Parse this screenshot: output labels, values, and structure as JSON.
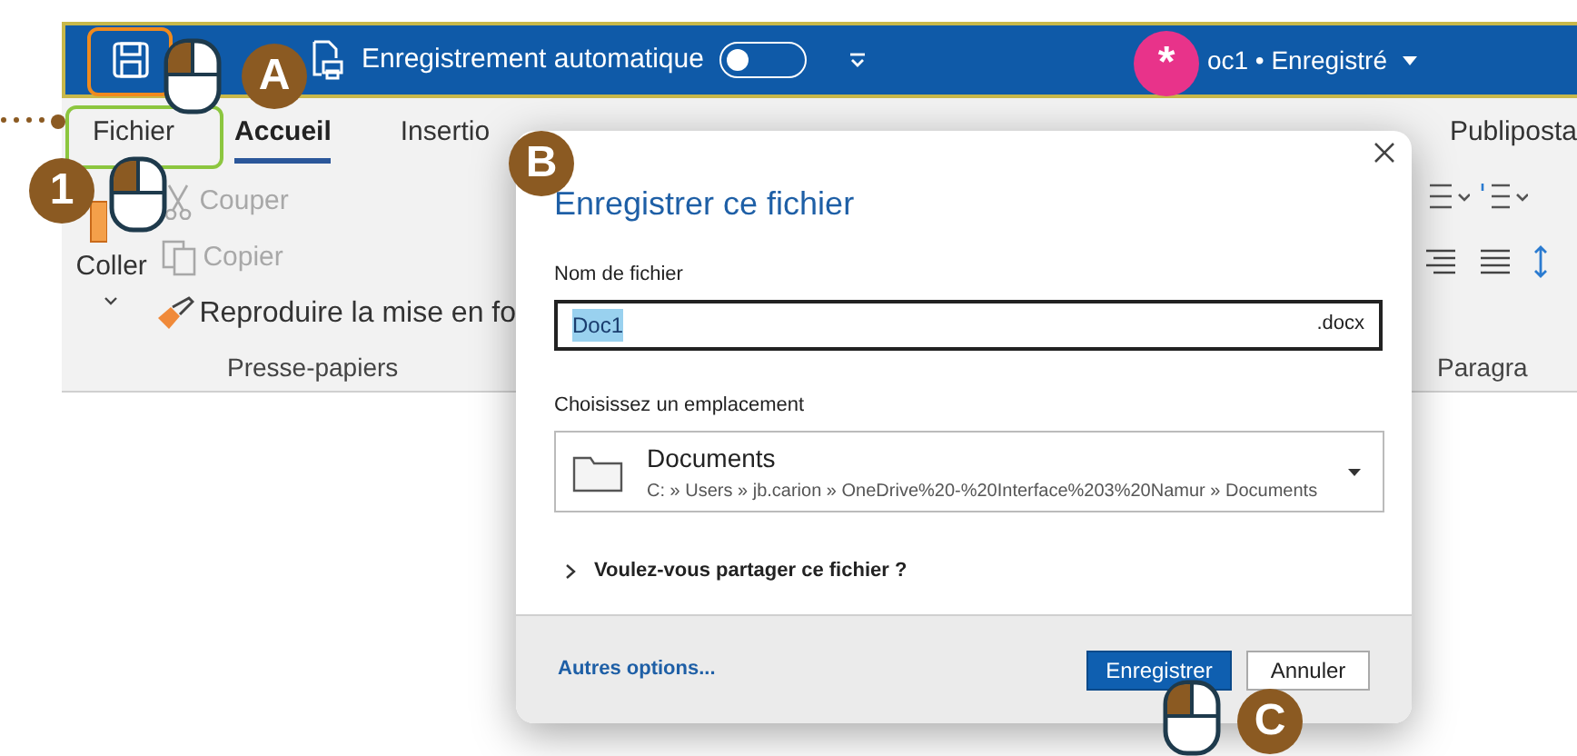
{
  "title_bar": {
    "autosave_label": "Enregistrement automatique",
    "autosave_on": false,
    "document_status": "oc1 • Enregistré"
  },
  "tabs": [
    {
      "label": "Fichier",
      "selected": false
    },
    {
      "label": "Accueil",
      "selected": true
    },
    {
      "label": "Insertio",
      "selected": false
    },
    {
      "label": "Publiposta",
      "selected": false
    }
  ],
  "clipboard": {
    "paste_label": "Coller",
    "items": [
      {
        "kind": "cut",
        "label": "Couper",
        "disabled": true
      },
      {
        "kind": "copy",
        "label": "Copier",
        "disabled": true
      },
      {
        "kind": "painter",
        "label": "Reproduire la mise en fo",
        "disabled": false
      }
    ],
    "group_label": "Presse-papiers"
  },
  "paragraph": {
    "group_label": "Paragra"
  },
  "dialog": {
    "title": "Enregistrer ce fichier",
    "filename_label": "Nom de fichier",
    "filename": {
      "value": "Doc1",
      "selected": true,
      "extension": ".docx"
    },
    "location_label": "Choisissez un emplacement",
    "location": {
      "name": "Documents",
      "path": "C: » Users » jb.carion » OneDrive%20-%20Interface%203%20Namur » Documents"
    },
    "share_label": "Voulez-vous partager ce fichier ?",
    "more_options": "Autres options...",
    "buttons": [
      {
        "label": "Enregistrer",
        "primary": true
      },
      {
        "label": "Annuler",
        "primary": false
      }
    ]
  },
  "annotations": [
    {
      "label": "A",
      "color": "#8b5a22"
    },
    {
      "label": "*",
      "color": "#e8338a"
    },
    {
      "label": "1",
      "color": "#8b5a22"
    },
    {
      "label": "B",
      "color": "#8b5a22"
    },
    {
      "label": "C",
      "color": "#8b5a22"
    }
  ]
}
